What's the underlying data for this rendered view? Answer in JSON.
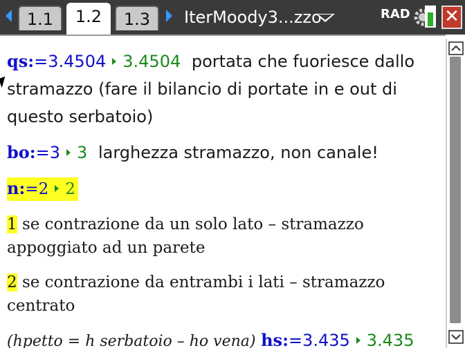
{
  "header": {
    "tabs": [
      {
        "label": "1.1",
        "active": false
      },
      {
        "label": "1.2",
        "active": true
      },
      {
        "label": "1.3",
        "active": false
      }
    ],
    "document_title": "IterMoody3...zzo",
    "angle_mode": "RAD",
    "battery_level": 0.75
  },
  "notes": {
    "qs": {
      "name": "qs:",
      "assign": "=3.4504",
      "result": "3.4504",
      "comment_1": "portata che fuoriesce dallo",
      "comment_2": "stramazzo (fare il bilancio di portate in e out di",
      "comment_3": "questo serbatoio)"
    },
    "bo": {
      "name": "bo:",
      "assign": "=3",
      "result": "3",
      "comment": "larghezza stramazzo, non canale!"
    },
    "n": {
      "name": "n:",
      "assign": "=2",
      "result": "2"
    },
    "opt1": {
      "num": "1",
      "text_1": "se contrazione da un solo lato – stramazzo",
      "text_2": "appoggiato ad un parete"
    },
    "opt2": {
      "num": "2",
      "text_1": "se contrazione da entrambi i lati – stramazzo",
      "text_2": "centrato"
    },
    "hs": {
      "note": "(hpetto = h serbatoio – ho vena)",
      "name": "hs:",
      "assign": "=3.435",
      "result": "3.435"
    }
  },
  "colors": {
    "variable": "#1010cc",
    "result": "#1a8a1a",
    "highlight": "#ffff22"
  }
}
